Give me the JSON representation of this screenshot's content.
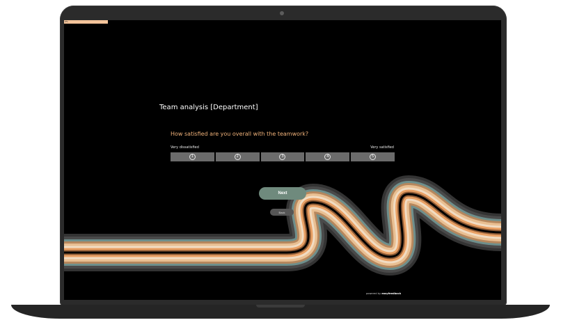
{
  "survey": {
    "progress_text": "0%",
    "progress_fraction": 0.1,
    "title": "Team analysis [Department]",
    "question": "How satisfied are you overall with the teamwork?",
    "scale_left_label": "Very dissatisfied",
    "scale_right_label": "Very satisfied",
    "options": [
      "1",
      "2",
      "3",
      "4",
      "5"
    ],
    "next_label": "Next",
    "back_label": "Back",
    "powered_prefix": "powered by",
    "powered_brand": "easyfeedback"
  },
  "colors": {
    "progress": "#f4c49a",
    "question": "#f0b27a",
    "next_button": "#6f8a7d",
    "option": "#6b6b6b",
    "background": "#000000"
  }
}
